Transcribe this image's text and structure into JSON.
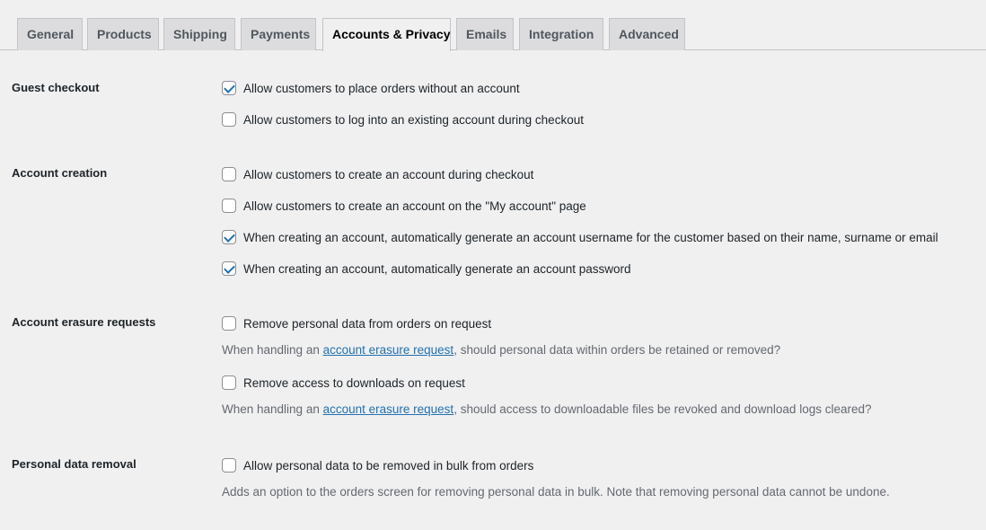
{
  "tabs": [
    {
      "label": "General"
    },
    {
      "label": "Products"
    },
    {
      "label": "Shipping"
    },
    {
      "label": "Payments"
    },
    {
      "label": "Accounts & Privacy",
      "active": true
    },
    {
      "label": "Emails"
    },
    {
      "label": "Integration"
    },
    {
      "label": "Advanced"
    }
  ],
  "guest_checkout": {
    "label": "Guest checkout",
    "options": [
      {
        "label": "Allow customers to place orders without an account",
        "checked": true
      },
      {
        "label": "Allow customers to log into an existing account during checkout",
        "checked": false
      }
    ]
  },
  "account_creation": {
    "label": "Account creation",
    "options": [
      {
        "label": "Allow customers to create an account during checkout",
        "checked": false
      },
      {
        "label": "Allow customers to create an account on the \"My account\" page",
        "checked": false
      },
      {
        "label": "When creating an account, automatically generate an account username for the customer based on their name, surname or email",
        "checked": true
      },
      {
        "label": "When creating an account, automatically generate an account password",
        "checked": true
      }
    ]
  },
  "erasure": {
    "label": "Account erasure requests",
    "options": [
      {
        "label": "Remove personal data from orders on request",
        "checked": false,
        "desc_prefix": "When handling an ",
        "desc_link": "account erasure request",
        "desc_suffix": ", should personal data within orders be retained or removed?"
      },
      {
        "label": "Remove access to downloads on request",
        "checked": false,
        "desc_prefix": "When handling an ",
        "desc_link": "account erasure request",
        "desc_suffix": ", should access to downloadable files be revoked and download logs cleared?"
      }
    ]
  },
  "personal_data_removal": {
    "label": "Personal data removal",
    "options": [
      {
        "label": "Allow personal data to be removed in bulk from orders",
        "checked": false
      }
    ],
    "desc": "Adds an option to the orders screen for removing personal data in bulk. Note that removing personal data cannot be undone."
  },
  "colors": {
    "background": "#f0f0f1",
    "accent": "#2271b1",
    "tab_inactive": "#dcdcde",
    "border": "#c3c4c7"
  },
  "icons": {
    "checkbox_checked": "check-icon"
  }
}
